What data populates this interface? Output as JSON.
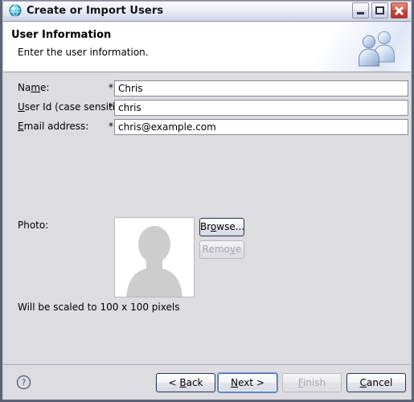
{
  "window": {
    "title": "Create or Import Users",
    "icon": "globe-icon",
    "controls": {
      "minimize": "Minimize",
      "maximize": "Maximize",
      "close": "Close"
    }
  },
  "header": {
    "title": "User Information",
    "subtitle": "Enter the user information.",
    "icon": "users-icon"
  },
  "form": {
    "fields": [
      {
        "label_pre": "Na",
        "label_mnemonic": "m",
        "label_post": "e:",
        "required_marker": "*",
        "value": "Chris"
      },
      {
        "label_pre": "",
        "label_mnemonic": "U",
        "label_post": "ser Id (case sensitive):",
        "required_marker": "*",
        "value": "chris"
      },
      {
        "label_pre": "",
        "label_mnemonic": "E",
        "label_post": "mail address:",
        "required_marker": "*",
        "value": "chris@example.com"
      }
    ],
    "photo": {
      "label": "Photo:",
      "placeholder_icon": "person-silhouette-icon",
      "scale_note": "Will be scaled to 100 x 100 pixels",
      "browse": {
        "pre": "Br",
        "mnemonic": "o",
        "post": "wse...",
        "enabled": true
      },
      "remove": {
        "pre": "Remo",
        "mnemonic": "v",
        "post": "e",
        "enabled": false
      }
    }
  },
  "footer": {
    "help_icon": "help-question-icon",
    "buttons": [
      {
        "pre": "< ",
        "mnemonic": "B",
        "post": "ack",
        "state": "enabled"
      },
      {
        "pre": "",
        "mnemonic": "N",
        "post": "ext >",
        "state": "default"
      },
      {
        "pre": "",
        "mnemonic": "F",
        "post": "inish",
        "state": "disabled"
      },
      {
        "pre": "",
        "mnemonic": "C",
        "post": "ancel",
        "state": "enabled"
      }
    ]
  },
  "colors": {
    "window_border": "#5d6277",
    "body_background": "#dcdce1",
    "header_background": "#ffffff",
    "button_border": "#26324f",
    "close_button": "#c4413a",
    "accent_blue": "#3a5fa8"
  }
}
